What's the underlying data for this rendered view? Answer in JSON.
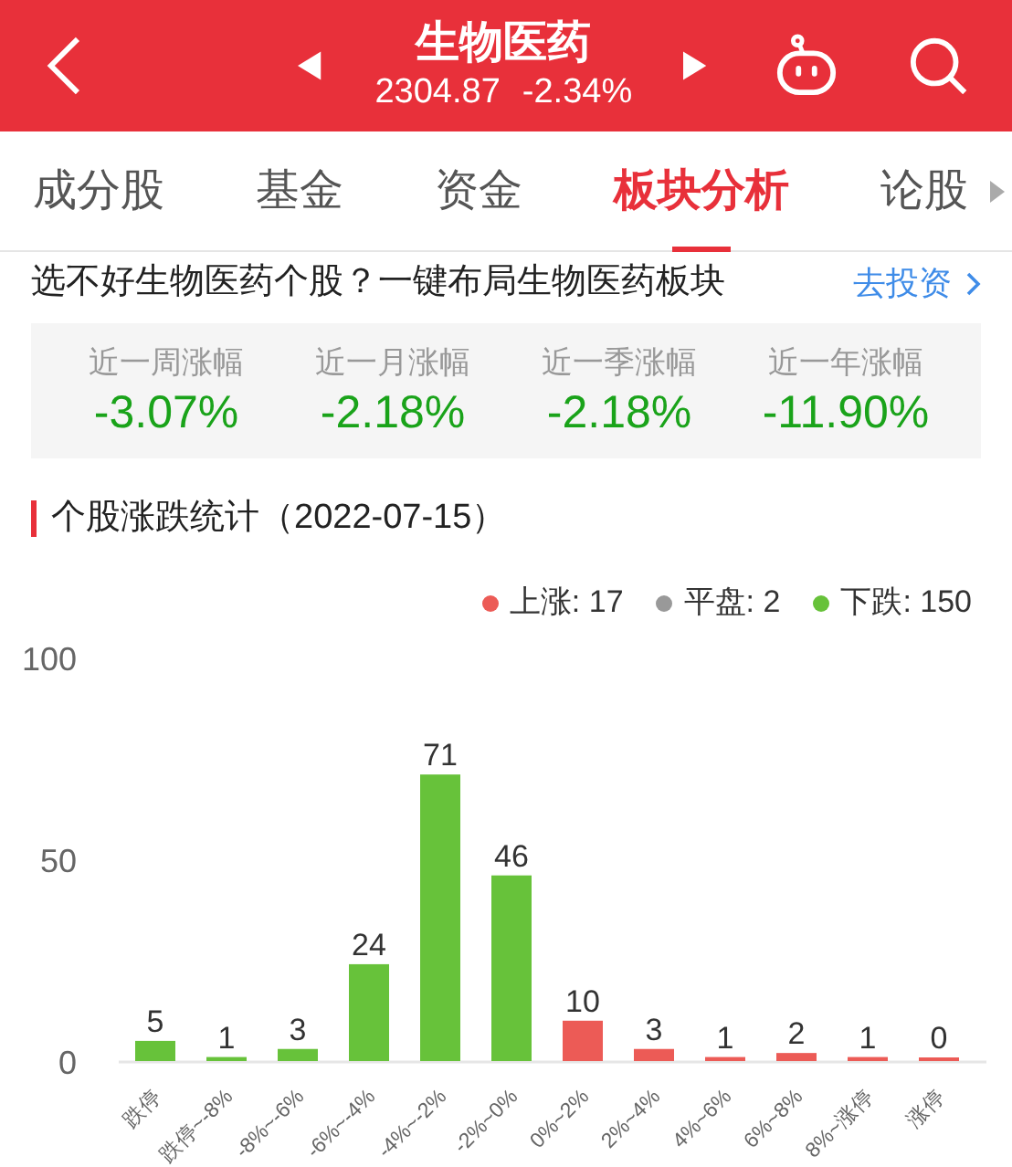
{
  "header": {
    "title": "生物医药",
    "price": "2304.87",
    "change": "-2.34%"
  },
  "tabs": [
    {
      "label": "成分股",
      "selected": false
    },
    {
      "label": "基金",
      "selected": false
    },
    {
      "label": "资金",
      "selected": false
    },
    {
      "label": "板块分析",
      "selected": true
    },
    {
      "label": "论股",
      "selected": false
    }
  ],
  "promo": {
    "text": "选不好生物医药个股？一键布局生物医药板块",
    "link": "去投资"
  },
  "returns": [
    {
      "label": "近一周涨幅",
      "value": "-3.07%"
    },
    {
      "label": "近一月涨幅",
      "value": "-2.18%"
    },
    {
      "label": "近一季涨幅",
      "value": "-2.18%"
    },
    {
      "label": "近一年涨幅",
      "value": "-11.90%"
    }
  ],
  "section_title": "个股涨跌统计（2022-07-15）",
  "legend": [
    {
      "label": "上涨: 17",
      "color": "#ec5b56"
    },
    {
      "label": "平盘: 2",
      "color": "#999999"
    },
    {
      "label": "下跌: 150",
      "color": "#67c23a"
    }
  ],
  "chart_data": {
    "type": "bar",
    "categories": [
      "跌停",
      "跌停~-8%",
      "-8%~-6%",
      "-6%~-4%",
      "-4%~-2%",
      "-2%~0%",
      "0%~2%",
      "2%~4%",
      "4%~6%",
      "6%~8%",
      "8%~涨停",
      "涨停"
    ],
    "series": [
      {
        "color": "#67c23a",
        "values": [
          5,
          1,
          3,
          24,
          71,
          46,
          null,
          null,
          null,
          null,
          null,
          null
        ]
      },
      {
        "color": "#ec5b56",
        "values": [
          null,
          null,
          null,
          null,
          null,
          null,
          10,
          3,
          1,
          2,
          1,
          0
        ]
      }
    ],
    "ylim": [
      0,
      100
    ],
    "yticks": [
      0,
      50,
      100
    ],
    "data_labels": true
  }
}
